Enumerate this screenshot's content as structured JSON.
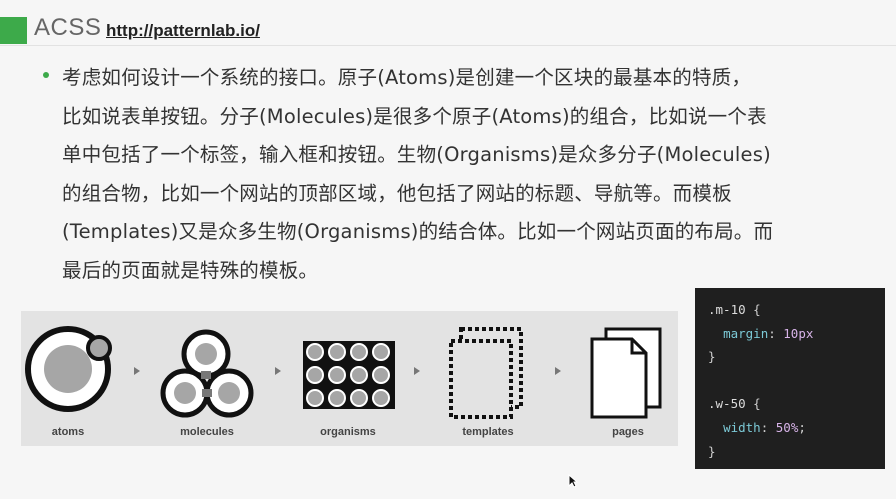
{
  "header": {
    "title": "ACSS",
    "link": "http://patternlab.io/"
  },
  "content": {
    "paragraph": "考虑如何设计一个系统的接口。原子(Atoms)是创建一个区块的最基本的特质，\n比如说表单按钮。分子(Molecules)是很多个原子(Atoms)的组合，比如说一个表\n单中包括了一个标签，输入框和按钮。生物(Organisms)是众多分子(Molecules)\n的组合物，比如一个网站的顶部区域，他包括了网站的标题、导航等。而模板\n(Templates)又是众多生物(Organisms)的结合体。比如一个网站页面的布局。而\n最后的页面就是特殊的模板。"
  },
  "diagram": {
    "stages": [
      {
        "label": "atoms",
        "icon": "atom-icon"
      },
      {
        "label": "molecules",
        "icon": "molecule-icon"
      },
      {
        "label": "organisms",
        "icon": "organism-icon"
      },
      {
        "label": "templates",
        "icon": "template-icon"
      },
      {
        "label": "pages",
        "icon": "pages-icon"
      }
    ]
  },
  "code": {
    "rule1": {
      "selector": ".m-10",
      "property": "margin",
      "value": "10px"
    },
    "rule2": {
      "selector": ".w-50",
      "property": "width",
      "value": "50%"
    },
    "open_brace": "{",
    "close_brace": "}"
  },
  "colors": {
    "accent": "#3daa4a",
    "code_bg": "#1f1f1f",
    "panel_bg": "#e3e3e3"
  }
}
